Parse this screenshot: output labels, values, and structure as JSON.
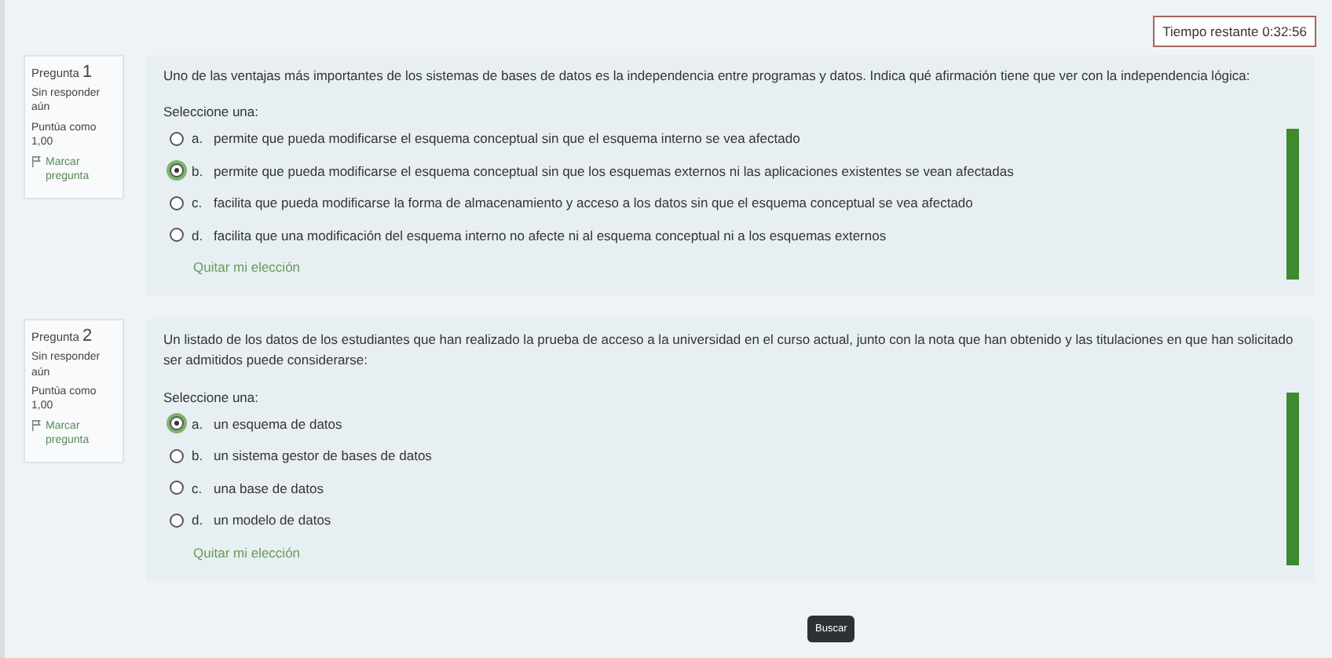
{
  "timer": "Tiempo restante 0:32:56",
  "questions": [
    {
      "label": "Pregunta",
      "number": "1",
      "status": "Sin responder aún",
      "score": "Puntúa como 1,00",
      "flag": "Marcar pregunta",
      "text": "Uno de las ventajas más importantes de los sistemas de bases de datos es la independencia entre programas y datos. Indica qué afirmación tiene que ver con la independencia lógica:",
      "prompt": "Seleccione una:",
      "options": [
        {
          "letter": "a.",
          "text": "permite que pueda modificarse el esquema conceptual sin que el esquema interno se vea afectado",
          "selected": false
        },
        {
          "letter": "b.",
          "text": "permite que pueda modificarse el esquema conceptual sin que los esquemas externos ni las aplicaciones existentes se vean afectadas",
          "selected": true
        },
        {
          "letter": "c.",
          "text": "facilita que pueda modificarse la forma de almacenamiento y acceso a los datos sin que el esquema conceptual se vea afectado",
          "selected": false
        },
        {
          "letter": "d.",
          "text": "facilita que una modificación del esquema interno no afecte ni al esquema conceptual ni a los esquemas externos",
          "selected": false
        }
      ],
      "clear": "Quitar mi elección"
    },
    {
      "label": "Pregunta",
      "number": "2",
      "status": "Sin responder aún",
      "score": "Puntúa como 1,00",
      "flag": "Marcar pregunta",
      "text": "Un listado de los datos de los estudiantes que han realizado la prueba de acceso a la universidad en el curso actual, junto con la nota que han obtenido y las titulaciones en que han solicitado ser admitidos puede considerarse:",
      "prompt": "Seleccione una:",
      "options": [
        {
          "letter": "a.",
          "text": "un esquema de datos",
          "selected": true
        },
        {
          "letter": "b.",
          "text": "un sistema gestor de bases de datos",
          "selected": false
        },
        {
          "letter": "c.",
          "text": "una base de datos",
          "selected": false
        },
        {
          "letter": "d.",
          "text": "un modelo de datos",
          "selected": false
        }
      ],
      "clear": "Quitar mi elección"
    }
  ],
  "tooltip": "Buscar"
}
